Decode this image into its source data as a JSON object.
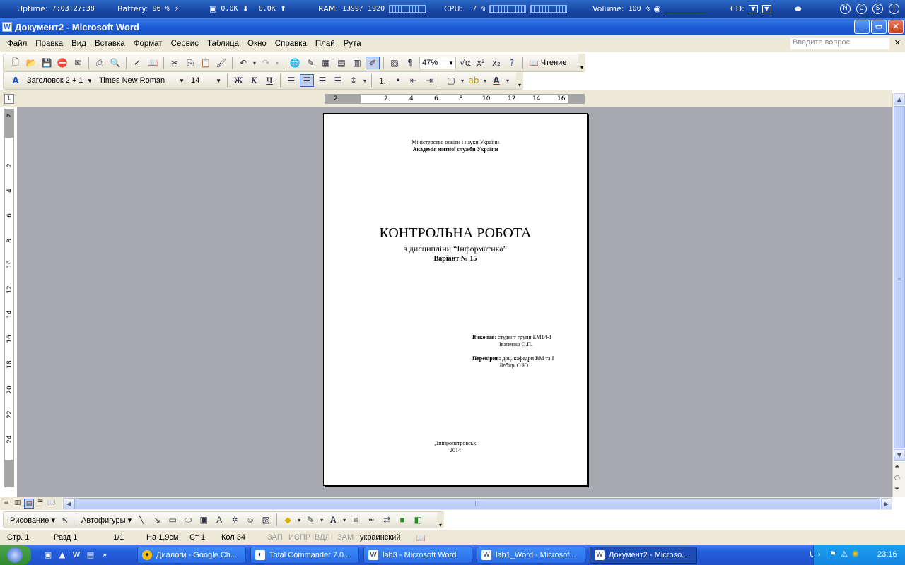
{
  "sysbar": {
    "uptime_label": "Uptime:",
    "uptime_value": "7:03:27:38",
    "battery_label": "Battery:",
    "battery_value": "96 %",
    "net_down": "0.0K",
    "net_up": "0.0K",
    "ram_label": "RAM:",
    "ram_value": "1399/ 1920",
    "cpu_label": "CPU:",
    "cpu_value": "7 %",
    "volume_label": "Volume:",
    "volume_value": "100 %",
    "cd_label": "CD:",
    "indicators": [
      "N",
      "C",
      "S",
      "I"
    ]
  },
  "window": {
    "title": "Документ2 - Microsoft Word"
  },
  "menu": {
    "items": [
      "Файл",
      "Правка",
      "Вид",
      "Вставка",
      "Формат",
      "Сервис",
      "Таблица",
      "Окно",
      "Справка",
      "Плай",
      "Рута"
    ],
    "ask_placeholder": "Введите вопрос"
  },
  "toolbar1": {
    "zoom": "47%",
    "read_label": "Чтение"
  },
  "toolbar2": {
    "style": "Заголовок 2 + 1",
    "font": "Times New Roman",
    "size": "14",
    "bold": "Ж",
    "italic": "К",
    "underline": "Ч"
  },
  "ruler": {
    "h_numbers": [
      "2",
      "2",
      "4",
      "6",
      "8",
      "10",
      "12",
      "14",
      "16"
    ],
    "v_numbers": [
      "2",
      "2",
      "4",
      "6",
      "8",
      "10",
      "12",
      "14",
      "16",
      "18",
      "20",
      "22",
      "24"
    ]
  },
  "document": {
    "ministry_line1": "Міністерство освіти і науки України",
    "ministry_line2": "Академія митної служби України",
    "title": "КОНТРОЛЬНА РОБОТА",
    "subtitle": "з дисципліни “Інформатика”",
    "variant": "Варіант № 15",
    "performed_label": "Виконав:",
    "performed_text": "студент групи ЕМ14-1",
    "performed_name": "Іваненко О.П.",
    "checked_label": "Перевірив:",
    "checked_text": "доц. кафедри ВМ та І",
    "checked_name": "Лебідь О.Ю.",
    "city": "Дніпропетровськ",
    "year": "2014"
  },
  "drawbar": {
    "drawing_label": "Рисование",
    "autoshapes_label": "Автофигуры"
  },
  "status": {
    "page": "Стр. 1",
    "section": "Разд 1",
    "pages": "1/1",
    "at": "На 1,9см",
    "line": "Ст 1",
    "col": "Кол 34",
    "rec": "ЗАП",
    "trk": "ИСПР",
    "ext": "ВДЛ",
    "ovr": "ЗАМ",
    "lang": "украинский"
  },
  "taskbar": {
    "buttons": [
      {
        "label": "Диалоги - Google Ch..."
      },
      {
        "label": "Total Commander 7.0..."
      },
      {
        "label": "lab3 - Microsoft Word"
      },
      {
        "label": "lab1_Word - Microsof..."
      },
      {
        "label": "Документ2 - Microso..."
      }
    ],
    "lang": "UK",
    "time": "23:16"
  }
}
